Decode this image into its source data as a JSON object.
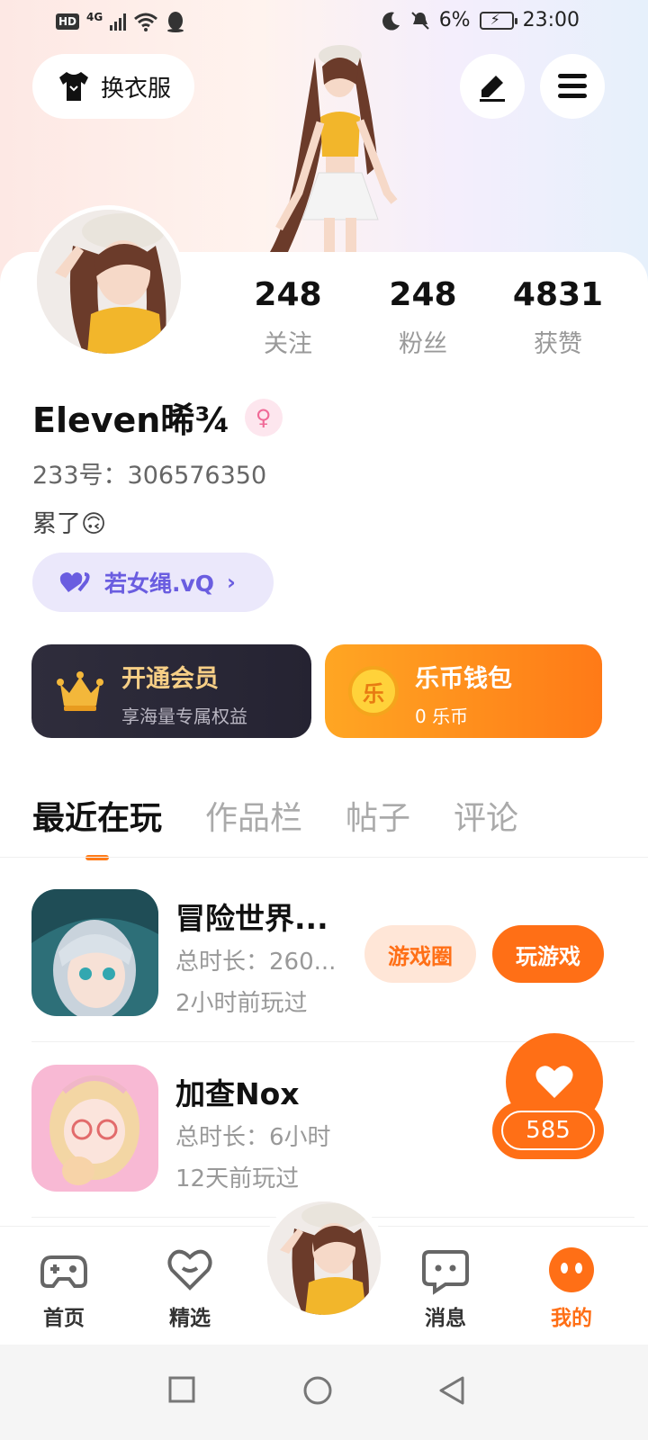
{
  "status_bar": {
    "hd": "HD",
    "network": "4G",
    "battery_percent": "6%",
    "time": "23:00"
  },
  "header": {
    "wardrobe_label": "换衣服",
    "icons": [
      "tshirt-icon",
      "pen-icon",
      "menu-icon"
    ]
  },
  "profile": {
    "stats": [
      {
        "value": "248",
        "label": "关注"
      },
      {
        "value": "248",
        "label": "粉丝"
      },
      {
        "value": "4831",
        "label": "获赞"
      }
    ],
    "username": "Eleven晞¾",
    "gender_symbol": "♀",
    "uid_label": "233号：306576350",
    "bio": "累了🙃",
    "tag": "若女绳.vQ"
  },
  "cards": {
    "vip": {
      "title": "开通会员",
      "subtitle": "享海量专属权益"
    },
    "coin": {
      "title": "乐币钱包",
      "subtitle": "0 乐币",
      "icon_char": "乐"
    }
  },
  "tabs": [
    "最近在玩",
    "作品栏",
    "帖子",
    "评论"
  ],
  "games": [
    {
      "name": "冒险世界...",
      "duration": "总时长：260...",
      "last_played": "2小时前玩过",
      "btn_circle": "游戏圈",
      "btn_play": "玩游戏"
    },
    {
      "name": "加查Nox",
      "duration": "总时长：6小时",
      "last_played": "12天前玩过"
    }
  ],
  "like_fab": {
    "count": "585"
  },
  "bottom_nav": [
    {
      "label": "首页"
    },
    {
      "label": "精选"
    },
    {
      "label": "消息"
    },
    {
      "label": "我的"
    }
  ],
  "colors": {
    "accent": "#ff6f16",
    "vip_gold": "#f7cf86",
    "tag_purple": "#6a5de0"
  }
}
